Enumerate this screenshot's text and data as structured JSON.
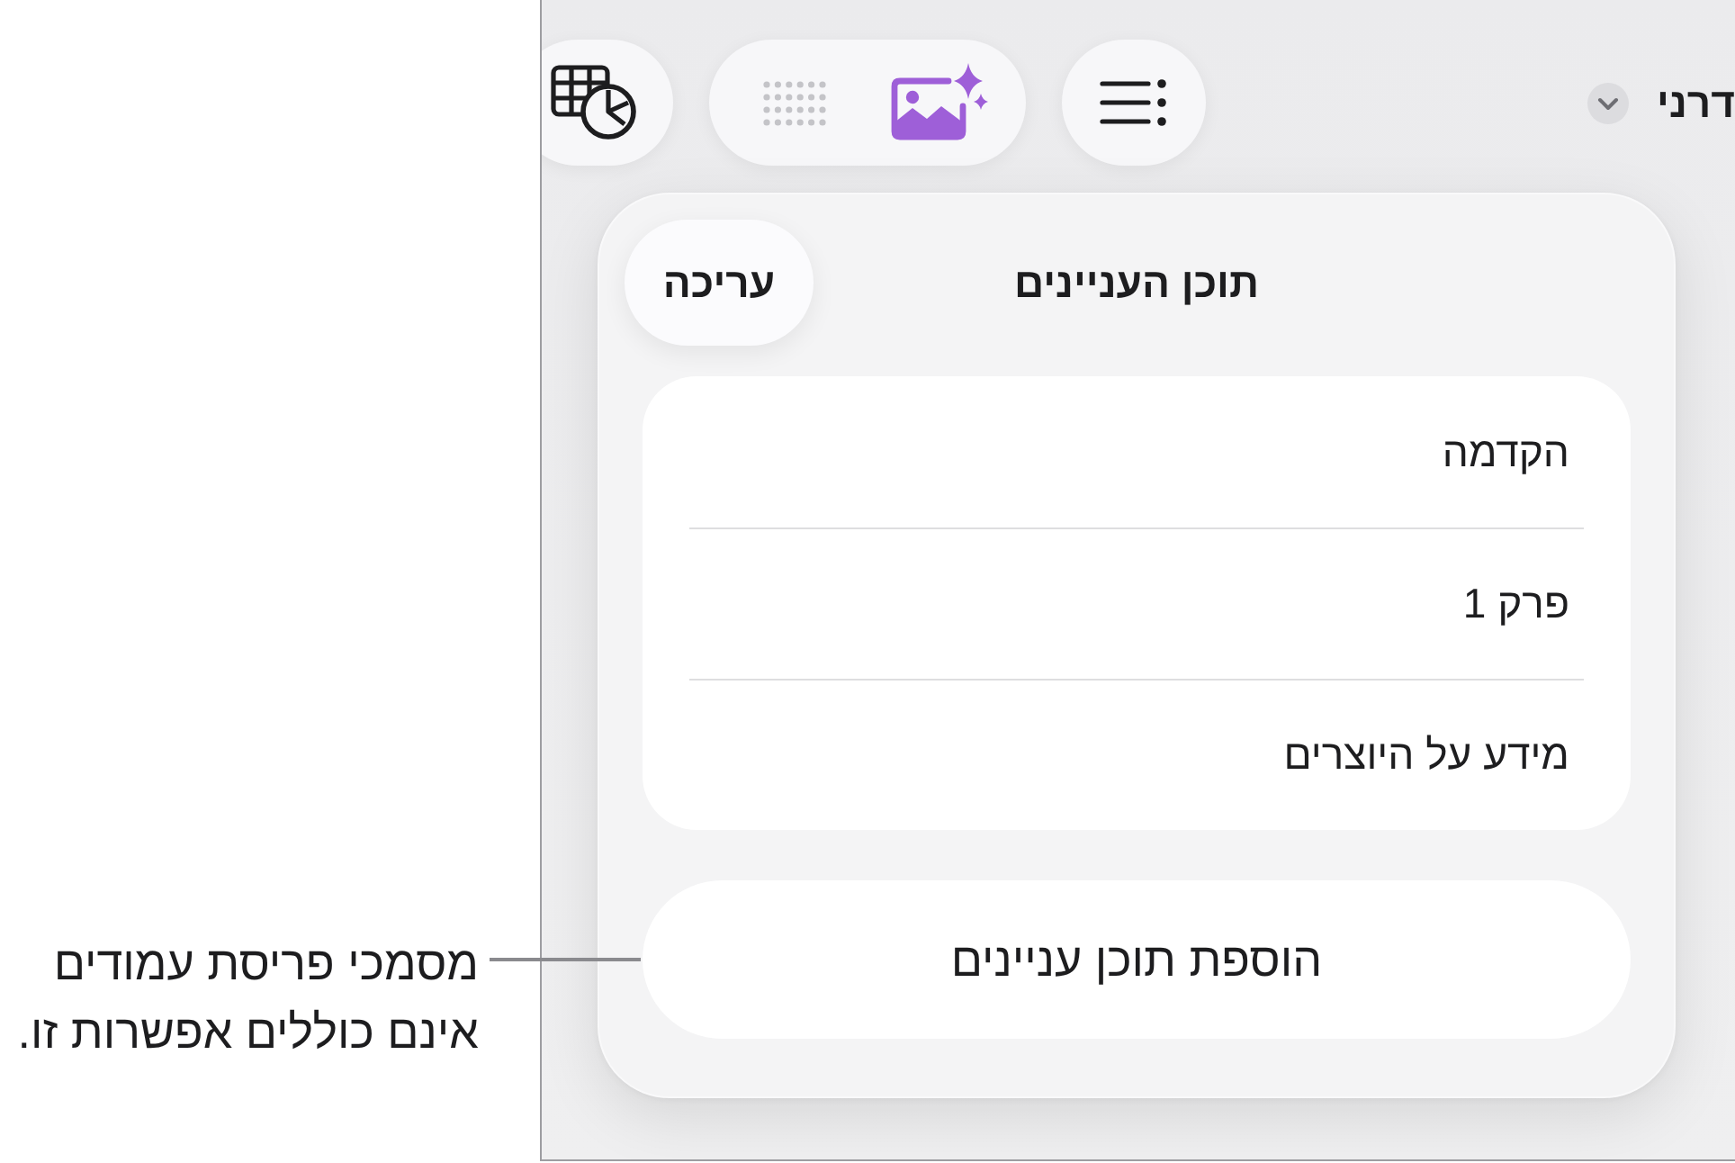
{
  "toolbar": {
    "document_title": "דרני",
    "tool_groups": [
      {
        "tools": [
          {
            "kind": "list",
            "disabled": false
          }
        ]
      },
      {
        "tools": [
          {
            "kind": "image",
            "disabled": false
          },
          {
            "kind": "dot-grid",
            "disabled": true
          }
        ]
      },
      {
        "tools": [
          {
            "kind": "table-chart",
            "disabled": false
          }
        ]
      }
    ]
  },
  "panel": {
    "title": "תוכן העניינים",
    "edit_button": "עריכה",
    "items": [
      "הקדמה",
      "פרק 1",
      "מידע על היוצרים"
    ],
    "add_button": "הוספת תוכן עניינים"
  },
  "callout": {
    "text": "מסמכי פריסת עמודים אינם כוללים אפשרות זו."
  }
}
